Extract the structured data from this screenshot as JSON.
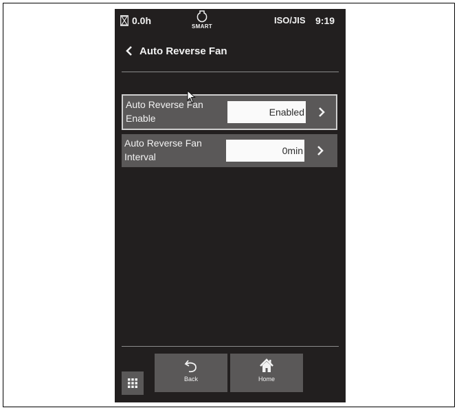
{
  "status_bar": {
    "hour_meter": "0.0h",
    "smart_label": "SMART",
    "standard": "ISO/JIS",
    "clock": "9:19"
  },
  "header": {
    "title": "Auto Reverse Fan"
  },
  "settings": [
    {
      "label_line1": "Auto Reverse Fan",
      "label_line2": "Enable",
      "value": "Enabled",
      "selected": true
    },
    {
      "label_line1": "Auto Reverse Fan",
      "label_line2": "Interval",
      "value": "0min",
      "selected": false
    }
  ],
  "bottom_nav": {
    "back_label": "Back",
    "home_label": "Home"
  },
  "colors": {
    "screen_bg": "#221f1f",
    "panel": "#5a5858",
    "text": "#f2f2f2",
    "value_box": "#fafafa"
  }
}
